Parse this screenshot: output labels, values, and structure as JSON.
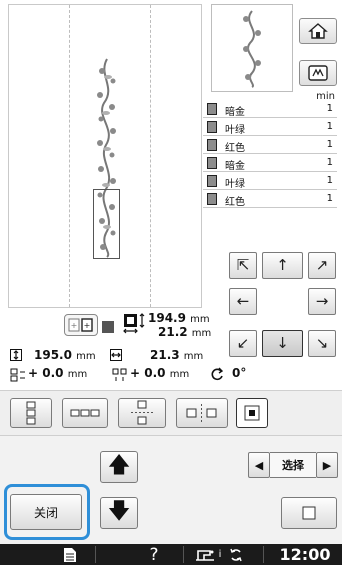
{
  "threads": {
    "time_unit_label": "min",
    "rows": [
      {
        "name": "暗金",
        "count": "1"
      },
      {
        "name": "叶绿",
        "count": "1"
      },
      {
        "name": "红色",
        "count": "1"
      },
      {
        "name": "暗金",
        "count": "1"
      },
      {
        "name": "叶绿",
        "count": "1"
      },
      {
        "name": "红色",
        "count": "1"
      }
    ]
  },
  "info": {
    "height_value": "194.9",
    "width_value": "21.2",
    "unit": "mm",
    "total_height_value": "195.0",
    "total_width_value": "21.3",
    "offset_x_prefix": "+",
    "offset_x_value": "0.0",
    "offset_y_prefix": "+",
    "offset_y_value": "0.0",
    "rotation_value": "0°"
  },
  "selector": {
    "label": "选择",
    "prev_icon": "◀",
    "next_icon": "▶"
  },
  "close_button": {
    "label": "关闭"
  },
  "status": {
    "help_icon": "?",
    "time": "12:00"
  },
  "colors": {
    "focus_ring": "#2f8fd8",
    "status_bar_bg": "#1b1b1b",
    "thread_swatch": "#8d8d8d"
  }
}
